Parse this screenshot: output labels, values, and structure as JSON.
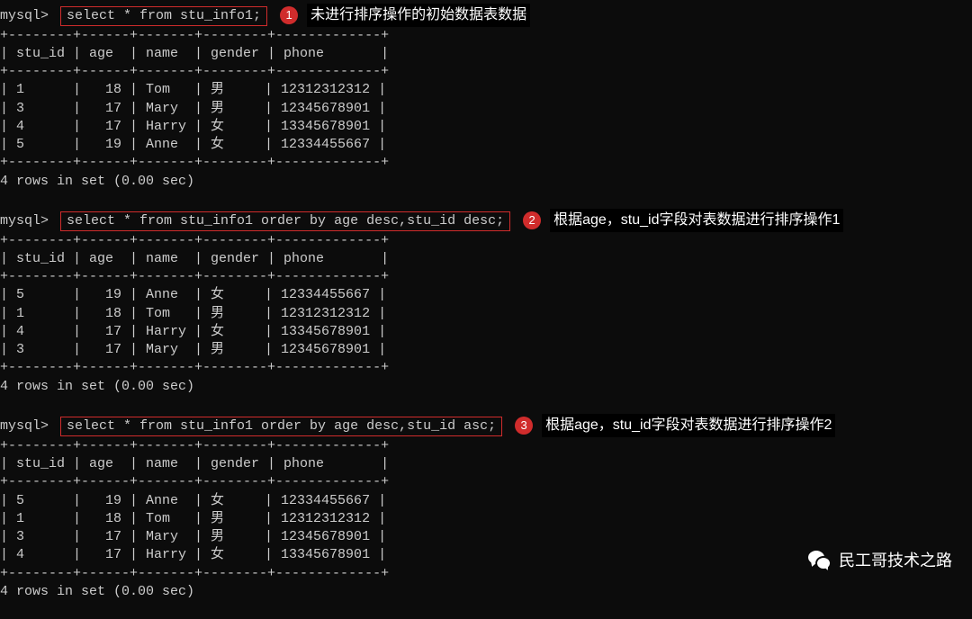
{
  "prompt": "mysql>",
  "queries": [
    {
      "sql": "select * from stu_info1;",
      "note": "未进行排序操作的初始数据表数据",
      "badge": "1"
    },
    {
      "sql": "select * from stu_info1 order by age desc,stu_id desc;",
      "note": "根据age，stu_id字段对表数据进行排序操作1",
      "badge": "2"
    },
    {
      "sql": "select * from stu_info1 order by age desc,stu_id asc;",
      "note": "根据age，stu_id字段对表数据进行排序操作2",
      "badge": "3"
    }
  ],
  "headers": [
    "stu_id",
    "age",
    "name",
    "gender",
    "phone"
  ],
  "tables": [
    [
      {
        "stu_id": "1",
        "age": "18",
        "name": "Tom",
        "gender": "男",
        "phone": "12312312312"
      },
      {
        "stu_id": "3",
        "age": "17",
        "name": "Mary",
        "gender": "男",
        "phone": "12345678901"
      },
      {
        "stu_id": "4",
        "age": "17",
        "name": "Harry",
        "gender": "女",
        "phone": "13345678901"
      },
      {
        "stu_id": "5",
        "age": "19",
        "name": "Anne",
        "gender": "女",
        "phone": "12334455667"
      }
    ],
    [
      {
        "stu_id": "5",
        "age": "19",
        "name": "Anne",
        "gender": "女",
        "phone": "12334455667"
      },
      {
        "stu_id": "1",
        "age": "18",
        "name": "Tom",
        "gender": "男",
        "phone": "12312312312"
      },
      {
        "stu_id": "4",
        "age": "17",
        "name": "Harry",
        "gender": "女",
        "phone": "13345678901"
      },
      {
        "stu_id": "3",
        "age": "17",
        "name": "Mary",
        "gender": "男",
        "phone": "12345678901"
      }
    ],
    [
      {
        "stu_id": "5",
        "age": "19",
        "name": "Anne",
        "gender": "女",
        "phone": "12334455667"
      },
      {
        "stu_id": "1",
        "age": "18",
        "name": "Tom",
        "gender": "男",
        "phone": "12312312312"
      },
      {
        "stu_id": "3",
        "age": "17",
        "name": "Mary",
        "gender": "男",
        "phone": "12345678901"
      },
      {
        "stu_id": "4",
        "age": "17",
        "name": "Harry",
        "gender": "女",
        "phone": "13345678901"
      }
    ]
  ],
  "result_msg": "4 rows in set (0.00 sec)",
  "footer_text": "民工哥技术之路",
  "sep_line": "+--------+------+-------+--------+-------------+",
  "widths": {
    "stu_id": 6,
    "age": 4,
    "name": 5,
    "gender": 6,
    "phone": 11
  }
}
